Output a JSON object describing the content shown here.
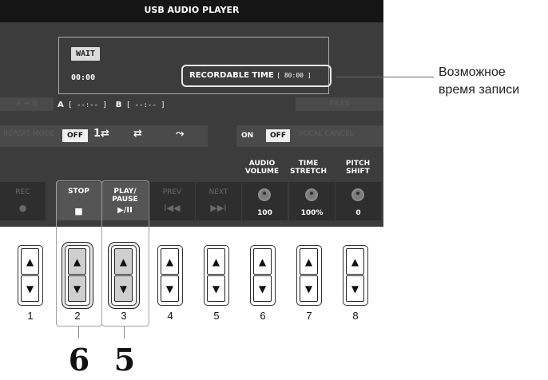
{
  "screen": {
    "title": "USB AUDIO PLAYER",
    "wait_label": "WAIT",
    "time": "00:00",
    "recordable_label": "RECORDABLE TIME",
    "recordable_value": "[ 80:00 ]",
    "ab_label": "A ↔ B",
    "a_marker": "A",
    "a_value": "[ --:-- ]",
    "b_marker": "B",
    "b_value": "[ --:-- ]",
    "files_label": "FILES",
    "repeat_label": "REPEAT MODE",
    "repeat_off": "OFF",
    "repeat_one_icon": "1⇄",
    "repeat_all_icon": "⇄",
    "repeat_random_icon": "⤳",
    "vocal_on": "ON",
    "vocal_off": "OFF",
    "vocal_label": "VOCAL CANCEL",
    "knobs": [
      {
        "title1": "AUDIO",
        "title2": "VOLUME",
        "value": "100"
      },
      {
        "title1": "TIME",
        "title2": "STRETCH",
        "value": "100%"
      },
      {
        "title1": "PITCH",
        "title2": "SHIFT",
        "value": "0"
      }
    ],
    "slots": [
      {
        "label1": "REC",
        "label2": "",
        "icon": "●"
      },
      {
        "label1": "STOP",
        "label2": "",
        "icon": "■"
      },
      {
        "label1": "PLAY/",
        "label2": "PAUSE",
        "icon": "▶/II"
      },
      {
        "label1": "PREV",
        "label2": "",
        "icon": "I◀◀"
      },
      {
        "label1": "NEXT",
        "label2": "",
        "icon": "▶▶I"
      }
    ]
  },
  "callout": {
    "line1": "Возможное",
    "line2": "время записи"
  },
  "buttons": {
    "up_icon": "▲",
    "down_icon": "▼",
    "numbers": [
      "1",
      "2",
      "3",
      "4",
      "5",
      "6",
      "7",
      "8"
    ]
  },
  "steps": [
    "6",
    "5"
  ],
  "colors": {
    "screen_bg": "#3c3c3c",
    "title_bg": "#151515",
    "active_slot": "#555555",
    "pressed_key": "#cfcfcf"
  }
}
